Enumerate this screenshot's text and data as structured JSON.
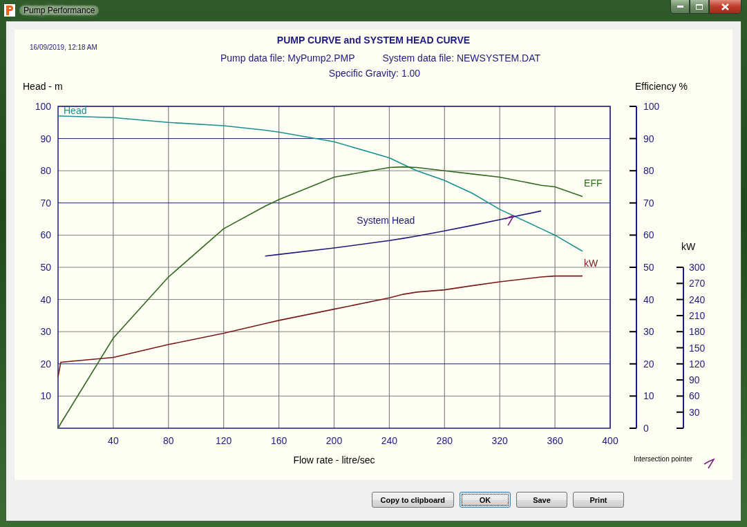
{
  "window": {
    "title": "Pump Performance"
  },
  "report": {
    "timestamp": "16/09/2019,  12:18 AM",
    "title": "PUMP CURVE and SYSTEM HEAD CURVE",
    "pump_file": "Pump data file:  MyPump2.PMP",
    "system_file": "System data file:  NEWSYSTEM.DAT",
    "gravity": "Specific Gravity:  1.00"
  },
  "plot": {
    "right_label": "Efficiency %",
    "kw_label": "kW",
    "intersection_label": "Intersection pointer",
    "efficiency_ticks": [
      "100",
      "90",
      "80",
      "70",
      "60",
      "50",
      "40",
      "30",
      "20",
      "10",
      "0"
    ],
    "kw_ticks": [
      "300",
      "270",
      "240",
      "210",
      "180",
      "150",
      "120",
      "90",
      "60",
      "30"
    ],
    "chart_data": {
      "type": "line",
      "grid": true,
      "xlabel": "Flow rate - litre/sec",
      "ylabel": "Head - m",
      "xlim": [
        0,
        400
      ],
      "ylim": [
        0,
        100
      ],
      "xticks": [
        40,
        80,
        120,
        160,
        200,
        240,
        280,
        320,
        360,
        400
      ],
      "yticks": [
        10,
        20,
        30,
        40,
        50,
        60,
        70,
        80,
        90,
        100
      ],
      "x": [
        0,
        2,
        40,
        80,
        120,
        150,
        160,
        200,
        240,
        250,
        260,
        280,
        300,
        320,
        350,
        360,
        380
      ],
      "series": [
        {
          "name": "Head",
          "color": "#1a9090",
          "values": [
            97,
            97,
            96.5,
            95,
            94,
            92.6,
            92,
            89,
            84,
            82,
            80,
            77,
            73,
            68,
            62,
            60,
            55
          ]
        },
        {
          "name": "EFF",
          "color": "#2d6a1e",
          "values": [
            0,
            1.5,
            28,
            47,
            62,
            69,
            71,
            78,
            81,
            81.2,
            81,
            80,
            79,
            78,
            75.5,
            75,
            72
          ]
        },
        {
          "name": "System Head",
          "color": "#1a1a80",
          "values": [
            null,
            null,
            null,
            null,
            null,
            53.5,
            54,
            56,
            58.3,
            59,
            59.7,
            61.3,
            63,
            64.8,
            67.5,
            null,
            null
          ]
        },
        {
          "name": "kW",
          "color": "#7a1a1a",
          "values": [
            16,
            20.5,
            22,
            26,
            29.5,
            32.5,
            33.5,
            37,
            40.5,
            41.6,
            42.3,
            43,
            44.3,
            45.5,
            47,
            47.3,
            47.3
          ]
        }
      ]
    }
  },
  "buttons": [
    {
      "label": "Copy to clipboard",
      "focused": false
    },
    {
      "label": "OK",
      "focused": true
    },
    {
      "label": "Save",
      "focused": false
    },
    {
      "label": "Print",
      "focused": false
    }
  ]
}
